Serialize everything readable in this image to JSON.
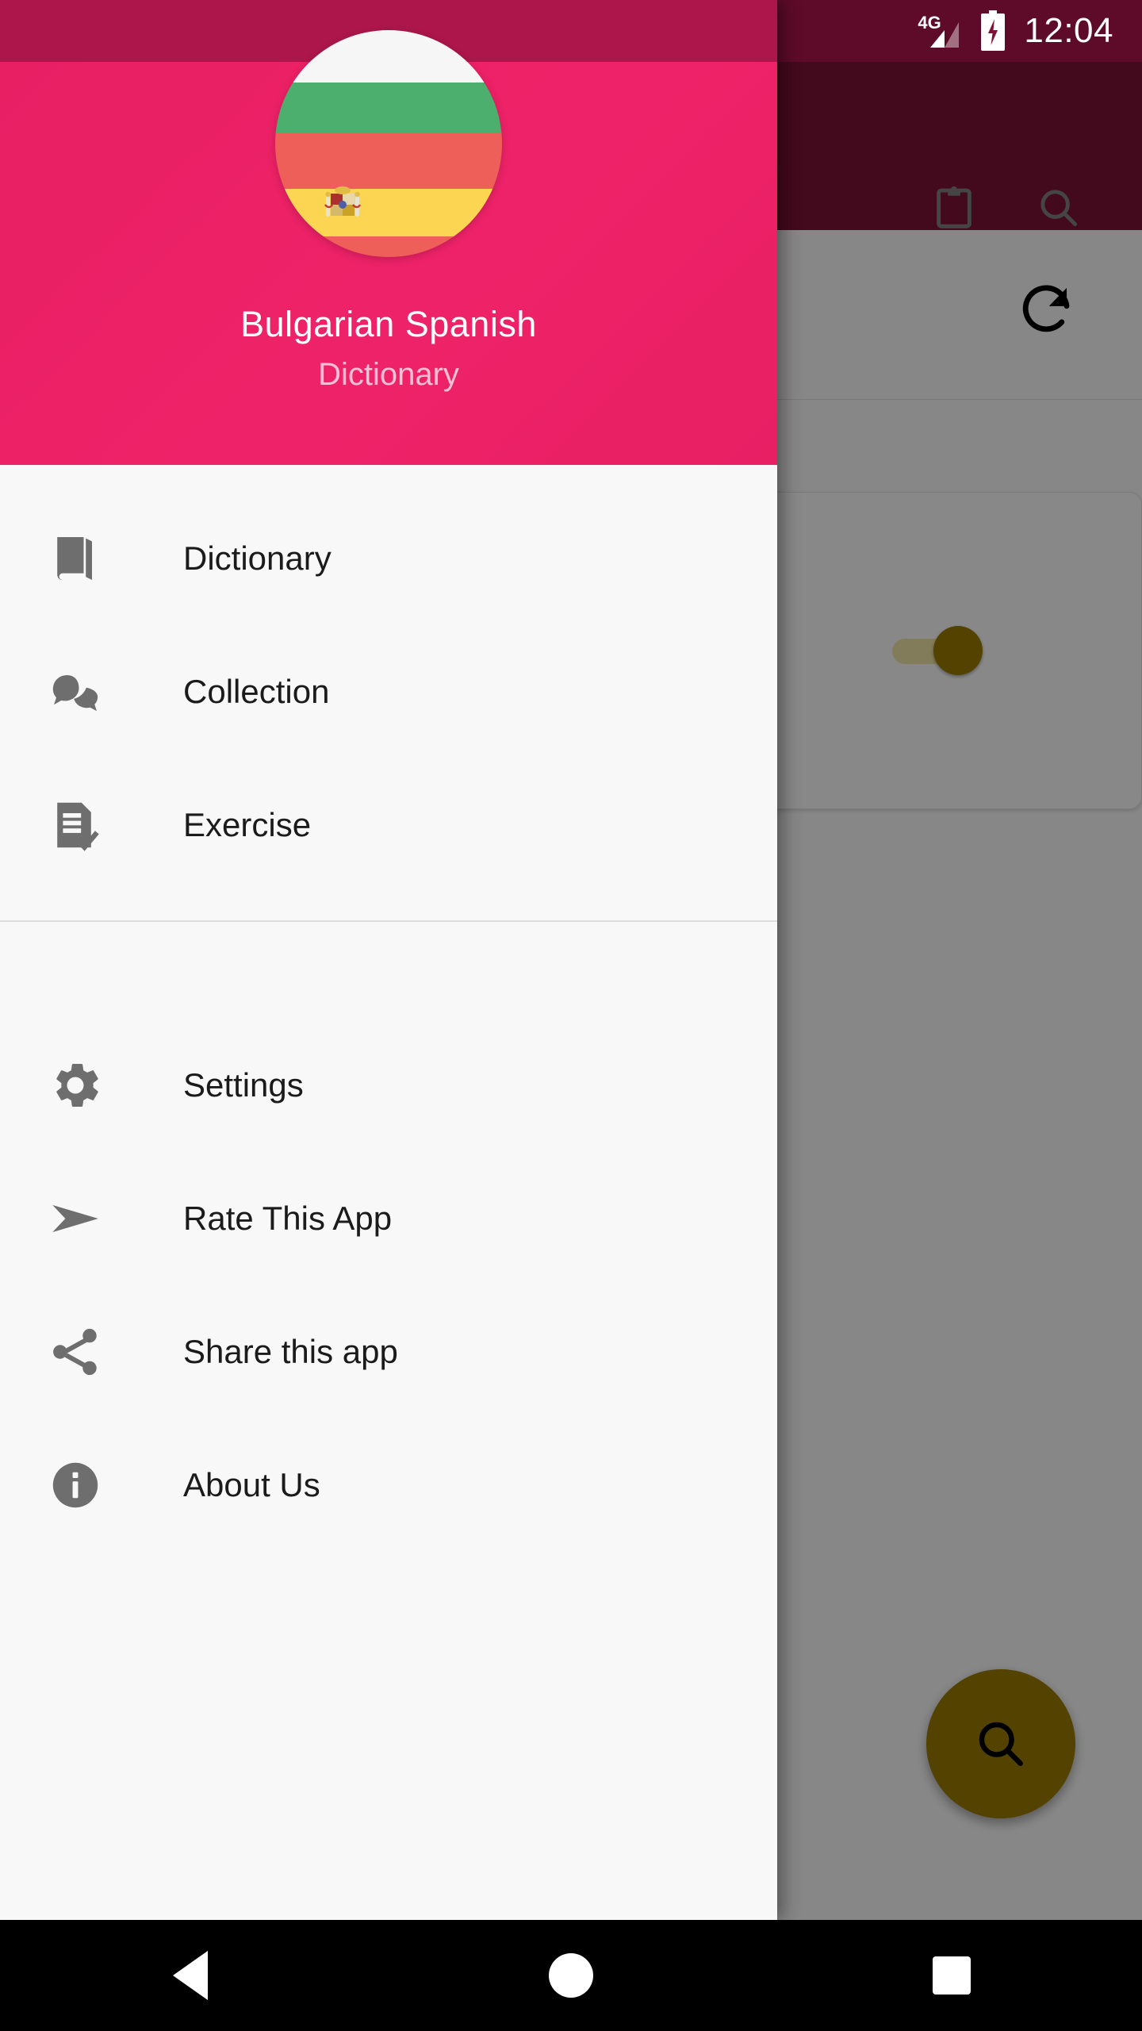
{
  "status_bar": {
    "network_label": "4G",
    "signal_icon": "signal-bars-icon",
    "battery_icon": "battery-charging-icon",
    "clock": "12:04",
    "background_color": "#AC164B"
  },
  "app": {
    "toolbar": {
      "background_color": "#7d1236",
      "actions": [
        {
          "name": "clipboard-icon",
          "label": "Clipboard"
        },
        {
          "name": "search-icon",
          "label": "Search"
        }
      ]
    },
    "content": {
      "refresh_button": {
        "name": "refresh-icon",
        "label": "Refresh"
      },
      "card_toggle": {
        "name": "toggle-switch",
        "state": "on",
        "accent_color": "#9c7c00"
      },
      "fab": {
        "name": "search-fab",
        "icon": "search-icon",
        "label": "Search",
        "color": "#9c7c00"
      }
    }
  },
  "drawer": {
    "header": {
      "title": "Bulgarian Spanish",
      "subtitle": "Dictionary",
      "background_color": "#E81F63",
      "avatar": {
        "name": "bulgarian-spanish-flag-avatar",
        "stripes": [
          "#f6f6f6",
          "#4caf6d",
          "#ef5f5a",
          "#fcd552",
          "#ef5f5a"
        ]
      }
    },
    "groups": [
      {
        "id": "primary",
        "items": [
          {
            "id": "dictionary",
            "label": "Dictionary",
            "icon": "book-icon"
          },
          {
            "id": "collection",
            "label": "Collection",
            "icon": "chat-bubbles-icon"
          },
          {
            "id": "exercise",
            "label": "Exercise",
            "icon": "checklist-document-icon"
          }
        ]
      },
      {
        "id": "secondary",
        "items": [
          {
            "id": "settings",
            "label": "Settings",
            "icon": "gear-icon"
          },
          {
            "id": "rate",
            "label": "Rate This App",
            "icon": "send-icon"
          },
          {
            "id": "share",
            "label": "Share this app",
            "icon": "share-icon"
          },
          {
            "id": "about",
            "label": "About Us",
            "icon": "info-icon"
          }
        ]
      }
    ]
  },
  "system_nav": {
    "back": "Back",
    "home": "Home",
    "recents": "Recent apps"
  }
}
